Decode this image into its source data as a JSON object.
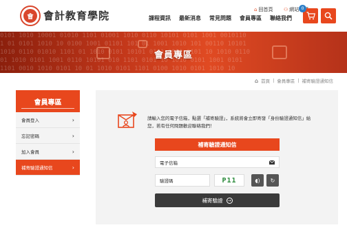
{
  "header": {
    "brand": "會計教育學院",
    "logo_text": "會",
    "util_links": [
      {
        "icon": "home-icon",
        "label": "回首頁"
      },
      {
        "icon": "sitemap-icon",
        "label": "網站導覽"
      }
    ],
    "nav": [
      "課程資訊",
      "最新消息",
      "常見問題",
      "會員專區",
      "聯絡我們"
    ],
    "cart_count": "0"
  },
  "banner": {
    "title": "會員專區",
    "binary": "0101 1010 10001 01010 1101 01001 1010 0110 10101 0101 1001 0010110\n1 01 0101 1010 10 0100 1001 01101 101 01 1001 1010 101 00110 10101\n1010 0110 01010 1101 01 1010 0101 10101 0101 0011 0101 10 1010 0110\n01 1010 0101 1001 0110 10101 010 1101 0101 10 1010 0101 1001 0101\n1101 0010 1010 0101 10 01 1010 0101 1101 0100 1010 0101 1010 10"
  },
  "breadcrumb": [
    "首頁",
    "會員專區",
    "補寄驗證通知信"
  ],
  "sidebar": {
    "title": "會員專區",
    "items": [
      {
        "label": "會員登入",
        "active": false
      },
      {
        "label": "忘記密碼",
        "active": false
      },
      {
        "label": "加入會員",
        "active": false
      },
      {
        "label": "補寄驗證通知信",
        "active": true
      }
    ]
  },
  "main": {
    "intro": "請輸入您的電子信箱，點選「補寄驗證」，系統將會立即寄發「身份驗證通知信」給您，若有任何問題歡迎聯絡我們！",
    "form_title": "補寄驗證通知信",
    "email_label": "電子信箱",
    "code_label": "驗證碼",
    "captcha_text": "P11",
    "submit_label": "補寄驗證"
  },
  "colors": {
    "accent": "#e8471d",
    "dark": "#3a3a3a",
    "badge": "#2e7fc7"
  }
}
